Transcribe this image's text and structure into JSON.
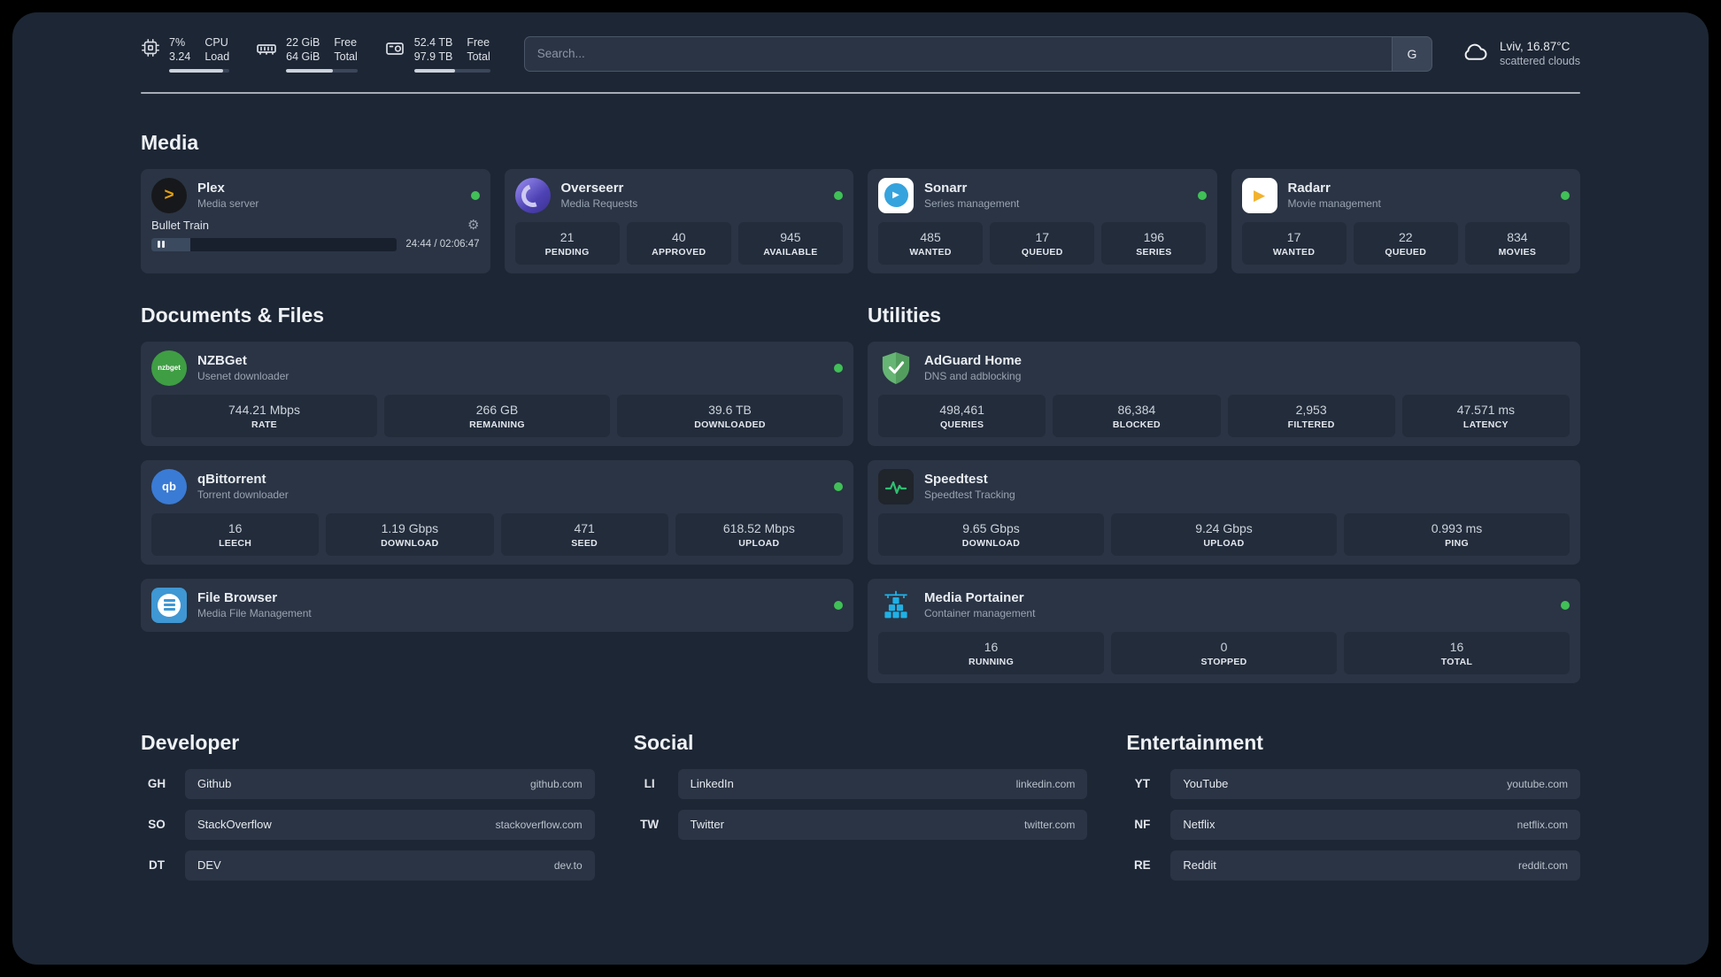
{
  "topbar": {
    "cpu": {
      "value_top": "7%",
      "value_bottom": "3.24",
      "label_top": "CPU",
      "label_bottom": "Load",
      "bar": "90%"
    },
    "ram": {
      "value_top": "22 GiB",
      "value_bottom": "64 GiB",
      "label_top": "Free",
      "label_bottom": "Total",
      "bar": "66%"
    },
    "disk": {
      "value_top": "52.4 TB",
      "value_bottom": "97.9 TB",
      "label_top": "Free",
      "label_bottom": "Total",
      "bar": "54%"
    },
    "search": {
      "placeholder": "Search...",
      "provider": "G"
    },
    "weather": {
      "location": "Lviv, 16.87°C",
      "condition": "scattered clouds"
    }
  },
  "sections": {
    "media": {
      "title": "Media",
      "apps": [
        {
          "name": "Plex",
          "subtitle": "Media server",
          "player": {
            "track": "Bullet Train",
            "time": "24:44 / 02:06:47",
            "progress": "16%"
          }
        },
        {
          "name": "Overseerr",
          "subtitle": "Media Requests",
          "stats": [
            {
              "value": "21",
              "label": "PENDING"
            },
            {
              "value": "40",
              "label": "APPROVED"
            },
            {
              "value": "945",
              "label": "AVAILABLE"
            }
          ]
        },
        {
          "name": "Sonarr",
          "subtitle": "Series management",
          "stats": [
            {
              "value": "485",
              "label": "WANTED"
            },
            {
              "value": "17",
              "label": "QUEUED"
            },
            {
              "value": "196",
              "label": "SERIES"
            }
          ]
        },
        {
          "name": "Radarr",
          "subtitle": "Movie management",
          "stats": [
            {
              "value": "17",
              "label": "WANTED"
            },
            {
              "value": "22",
              "label": "QUEUED"
            },
            {
              "value": "834",
              "label": "MOVIES"
            }
          ]
        }
      ]
    },
    "documents": {
      "title": "Documents & Files",
      "apps": [
        {
          "name": "NZBGet",
          "subtitle": "Usenet downloader",
          "stats": [
            {
              "value": "744.21 Mbps",
              "label": "RATE"
            },
            {
              "value": "266 GB",
              "label": "REMAINING"
            },
            {
              "value": "39.6 TB",
              "label": "DOWNLOADED"
            }
          ]
        },
        {
          "name": "qBittorrent",
          "subtitle": "Torrent downloader",
          "stats": [
            {
              "value": "16",
              "label": "LEECH"
            },
            {
              "value": "1.19 Gbps",
              "label": "DOWNLOAD"
            },
            {
              "value": "471",
              "label": "SEED"
            },
            {
              "value": "618.52 Mbps",
              "label": "UPLOAD"
            }
          ]
        },
        {
          "name": "File Browser",
          "subtitle": "Media File Management"
        }
      ]
    },
    "utilities": {
      "title": "Utilities",
      "apps": [
        {
          "name": "AdGuard Home",
          "subtitle": "DNS and adblocking",
          "stats": [
            {
              "value": "498,461",
              "label": "QUERIES"
            },
            {
              "value": "86,384",
              "label": "BLOCKED"
            },
            {
              "value": "2,953",
              "label": "FILTERED"
            },
            {
              "value": "47.571 ms",
              "label": "LATENCY"
            }
          ]
        },
        {
          "name": "Speedtest",
          "subtitle": "Speedtest Tracking",
          "stats": [
            {
              "value": "9.65 Gbps",
              "label": "DOWNLOAD"
            },
            {
              "value": "9.24 Gbps",
              "label": "UPLOAD"
            },
            {
              "value": "0.993 ms",
              "label": "PING"
            }
          ]
        },
        {
          "name": "Media Portainer",
          "subtitle": "Container management",
          "stats": [
            {
              "value": "16",
              "label": "RUNNING"
            },
            {
              "value": "0",
              "label": "STOPPED"
            },
            {
              "value": "16",
              "label": "TOTAL"
            }
          ]
        }
      ]
    },
    "bookmarks": {
      "groups": [
        {
          "title": "Developer",
          "items": [
            {
              "abbr": "GH",
              "name": "Github",
              "url": "github.com"
            },
            {
              "abbr": "SO",
              "name": "StackOverflow",
              "url": "stackoverflow.com"
            },
            {
              "abbr": "DT",
              "name": "DEV",
              "url": "dev.to"
            }
          ]
        },
        {
          "title": "Social",
          "items": [
            {
              "abbr": "LI",
              "name": "LinkedIn",
              "url": "linkedin.com"
            },
            {
              "abbr": "TW",
              "name": "Twitter",
              "url": "twitter.com"
            }
          ]
        },
        {
          "title": "Entertainment",
          "items": [
            {
              "abbr": "YT",
              "name": "YouTube",
              "url": "youtube.com"
            },
            {
              "abbr": "NF",
              "name": "Netflix",
              "url": "netflix.com"
            },
            {
              "abbr": "RE",
              "name": "Reddit",
              "url": "reddit.com"
            }
          ]
        }
      ]
    }
  },
  "icons": {
    "nzbget_text": "nzbget",
    "qbit_text": "qb",
    "plex_glyph": ">",
    "play_glyph": "▶",
    "gear_glyph": "⚙"
  },
  "colors": {
    "status_online": "#40c057",
    "accent_green": "#2fbf71",
    "plex_gold": "#e5a00d"
  }
}
